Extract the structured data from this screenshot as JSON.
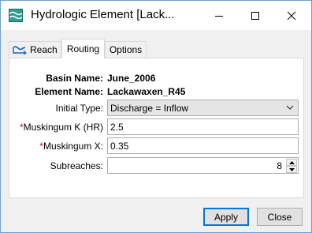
{
  "window": {
    "title": "Hydrologic Element [Lack..."
  },
  "tabs": [
    {
      "label": "Reach",
      "icon": "reach-icon",
      "active": false
    },
    {
      "label": "Routing",
      "active": true
    },
    {
      "label": "Options",
      "active": false
    }
  ],
  "form": {
    "basin_label": "Basin Name:",
    "basin_value": "June_2006",
    "element_label": "Element Name:",
    "element_value": "Lackawaxen_R45",
    "initial_type_label": "Initial Type:",
    "initial_type_value": "Discharge = Inflow",
    "required_mark": "*",
    "muskingum_k_label": "Muskingum K (HR)",
    "muskingum_k_value": "2.5",
    "muskingum_x_label": "Muskingum X:",
    "muskingum_x_value": "0.35",
    "subreaches_label": "Subreaches:",
    "subreaches_value": "8"
  },
  "buttons": {
    "apply": "Apply",
    "close": "Close"
  },
  "colors": {
    "required": "#d0021b",
    "accent": "#0078d7"
  }
}
